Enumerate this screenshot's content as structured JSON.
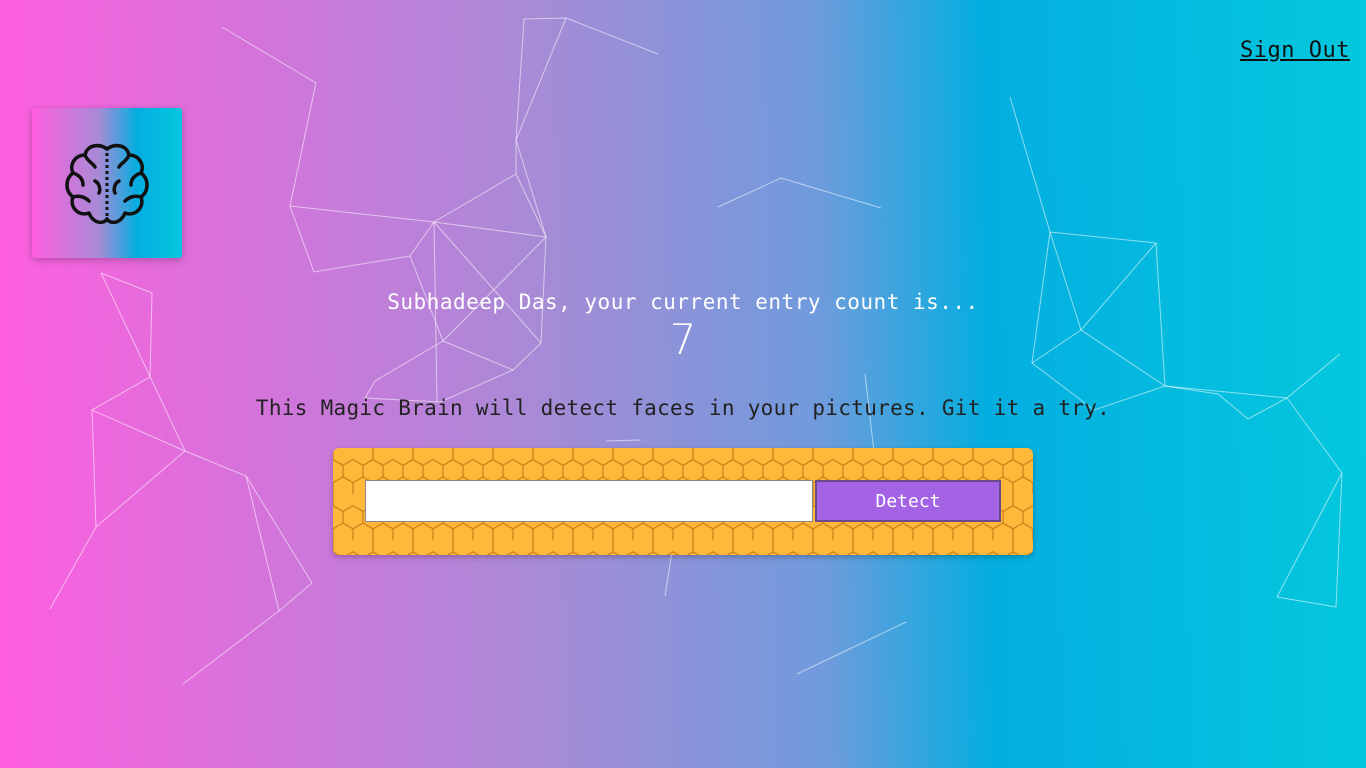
{
  "nav": {
    "signout_label": "Sign Out"
  },
  "logo": {
    "icon": "brain-icon"
  },
  "rank": {
    "message": "Subhadeep Das, your current entry count is...",
    "count": "7"
  },
  "tagline": "This Magic Brain will detect faces in your pictures. Git it a try.",
  "form": {
    "input_value": "",
    "placeholder": "",
    "button_label": "Detect"
  },
  "colors": {
    "gradient_left": "#ff5edf",
    "gradient_mid": "#a68bd6",
    "gradient_right": "#04c8de",
    "panel": "#ffb83a",
    "button": "#a463e5"
  }
}
